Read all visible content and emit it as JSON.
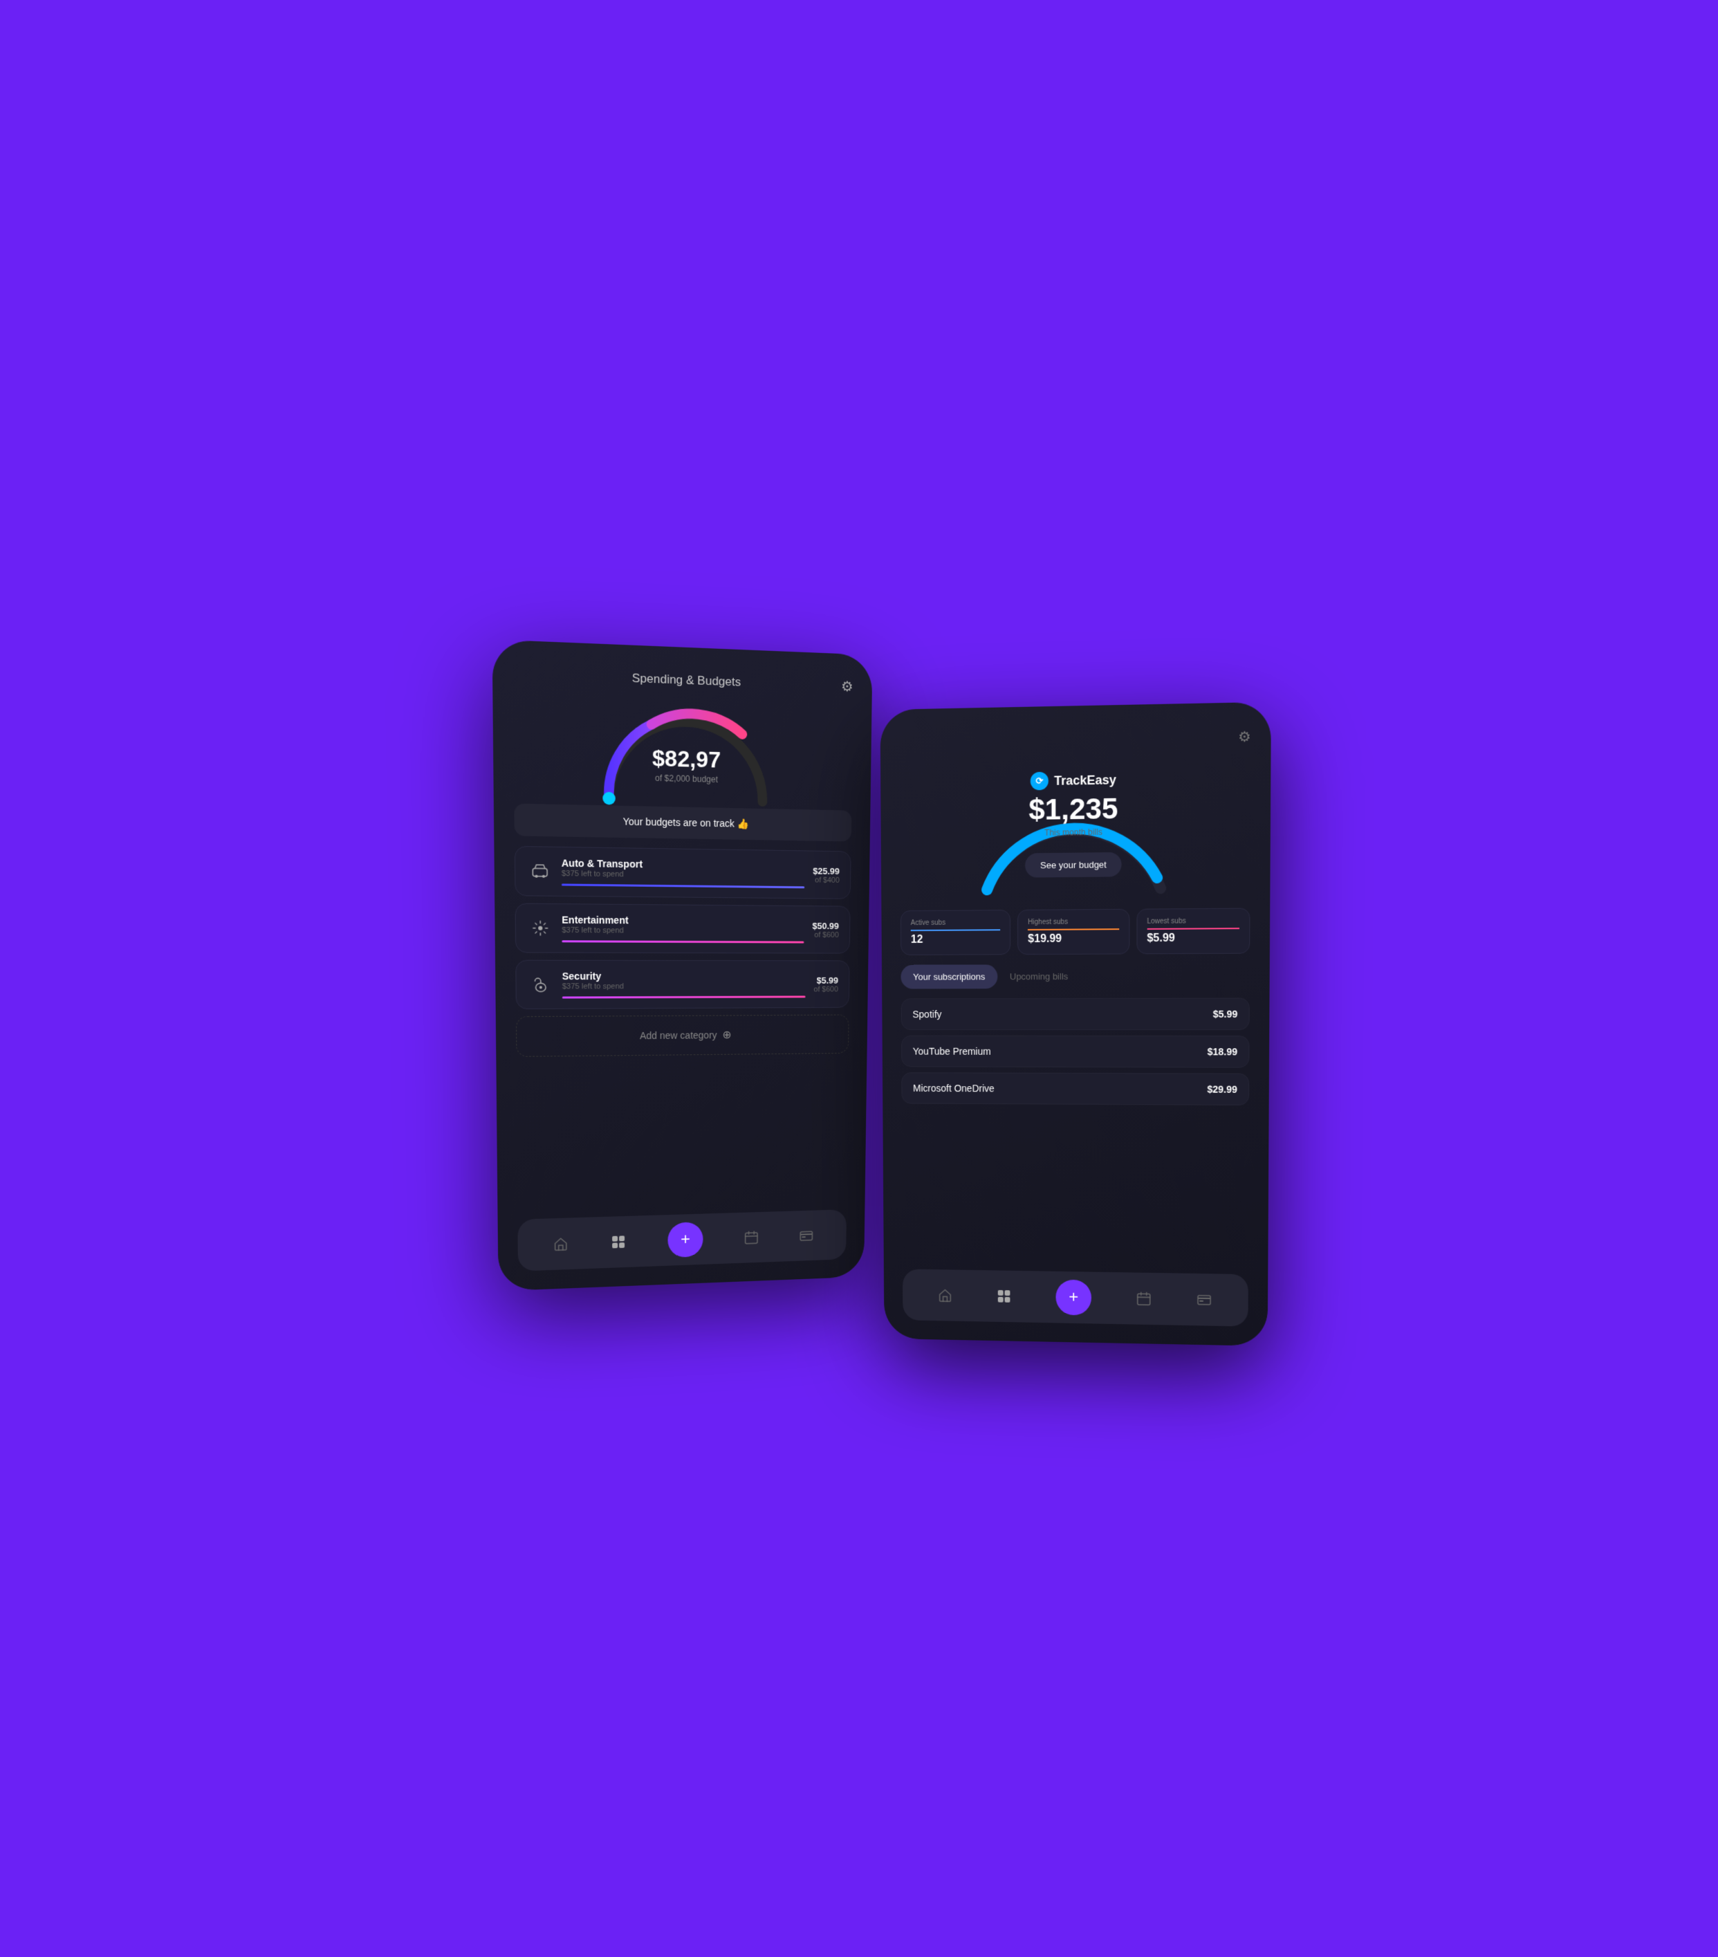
{
  "background": "#6B21F5",
  "leftPhone": {
    "title": "Spending & Budgets",
    "gauge": {
      "amount": "$82,97",
      "budget_label": "of $2,000 budget"
    },
    "on_track_text": "Your budgets are on track 👍",
    "categories": [
      {
        "name": "Auto & Transport",
        "left_to_spend": "$375 left to spend",
        "spent": "$25.99",
        "budget": "of $400",
        "progress_color": "blue",
        "icon": "🚗"
      },
      {
        "name": "Entertainment",
        "left_to_spend": "$375 left to spend",
        "spent": "$50.99",
        "budget": "of $600",
        "progress_color": "pink",
        "icon": "✨"
      },
      {
        "name": "Security",
        "left_to_spend": "$375 left to spend",
        "spent": "$5.99",
        "budget": "of $600",
        "progress_color": "pink",
        "icon": "🔐"
      }
    ],
    "add_category_label": "Add new category",
    "nav": {
      "items": [
        "home",
        "grid",
        "add",
        "calendar",
        "card"
      ]
    }
  },
  "rightPhone": {
    "logo_text": "TrackEasy",
    "amount": "$1,235",
    "month_label": "This month bills",
    "see_budget_btn": "See your budget",
    "stats": [
      {
        "label": "Active subs",
        "value": "12",
        "color": "blue"
      },
      {
        "label": "Highest subs",
        "value": "$19.99",
        "color": "orange"
      },
      {
        "label": "Lowest subs",
        "value": "$5.99",
        "color": "pink"
      }
    ],
    "tabs": [
      {
        "label": "Your subscriptions",
        "active": true
      },
      {
        "label": "Upcoming bills",
        "active": false
      }
    ],
    "subscriptions": [
      {
        "name": "Spotify",
        "price": "$5.99"
      },
      {
        "name": "YouTube Premium",
        "price": "$18.99"
      },
      {
        "name": "Microsoft OneDrive",
        "price": "$29.99"
      }
    ],
    "nav": {
      "items": [
        "home",
        "grid",
        "add",
        "calendar",
        "card"
      ]
    }
  }
}
